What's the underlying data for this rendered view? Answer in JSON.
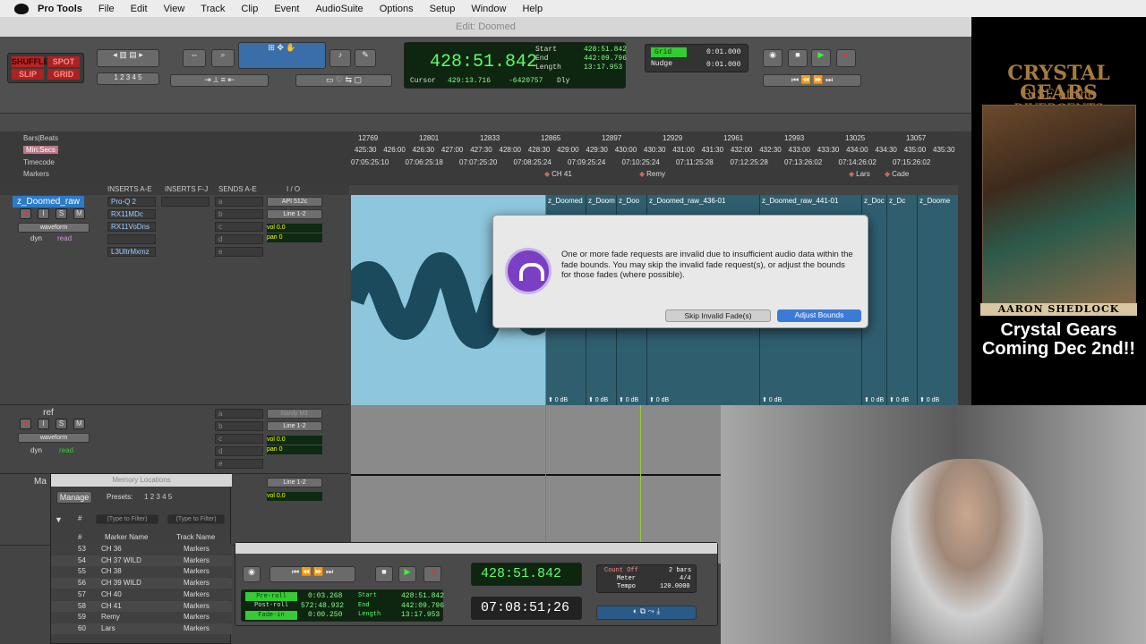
{
  "menubar": {
    "app": "Pro Tools",
    "items": [
      "File",
      "Edit",
      "View",
      "Track",
      "Clip",
      "Event",
      "AudioSuite",
      "Options",
      "Setup",
      "Window",
      "Help"
    ]
  },
  "window": {
    "title": "Edit: Doomed"
  },
  "toolbar": {
    "modes": [
      "SHUFFLE",
      "SPOT",
      "SLIP",
      "GRID"
    ],
    "nums": [
      "1",
      "2",
      "3",
      "4",
      "5"
    ],
    "main_counter": "428:51.842",
    "start_label": "Start",
    "end_label": "End",
    "length_label": "Length",
    "start": "428:51.842",
    "end": "442:09.796",
    "length": "13:17.953",
    "cursor_label": "Cursor",
    "cursor": "429:13.716",
    "sample": "-6420757",
    "dly": "Dly",
    "grid_label": "Grid",
    "grid_value": "0:01.000",
    "nudge_label": "Nudge",
    "nudge_value": "0:01.000"
  },
  "rulers": {
    "labels": [
      "Bars|Beats",
      "Min:Secs",
      "Timecode",
      "Markers"
    ],
    "bars": [
      "12769",
      "12801",
      "12833",
      "12865",
      "12897",
      "12929",
      "12961",
      "12993",
      "13025",
      "13057"
    ],
    "minsecs": [
      "425:30",
      "426:00",
      "426:30",
      "427:00",
      "427:30",
      "428:00",
      "428:30",
      "429:00",
      "429:30",
      "430:00",
      "430:30",
      "431:00",
      "431:30",
      "432:00",
      "432:30",
      "433:00",
      "433:30",
      "434:00",
      "434:30",
      "435:00",
      "435:30"
    ],
    "timecode": [
      "07:05:25:10",
      "07:06:25:18",
      "07:07:25:20",
      "07:08:25:24",
      "07:09:25:24",
      "07:10:25:24",
      "07:11:25:28",
      "07:12:25:28",
      "07:13:26:02",
      "07:14:26:02",
      "07:15:26:02"
    ],
    "markers": [
      "CH 41",
      "Remy",
      "Lars",
      "Cade"
    ]
  },
  "mix_header": {
    "inserts_ae": "INSERTS A-E",
    "inserts_fj": "INSERTS F-J",
    "sends_ae": "SENDS A-E",
    "io": "I / O"
  },
  "tracks": [
    {
      "name": "z_Doomed_raw",
      "view": "waveform",
      "dyn": "dyn",
      "mode": "read",
      "inserts": [
        "Pro-Q 2",
        "RX11MDc",
        "RX11VoDns",
        "",
        "L3UltrMxmz"
      ],
      "sends": [
        "a",
        "b",
        "c",
        "d",
        "e"
      ],
      "input": "API 512c",
      "output": "Line 1-2",
      "vol": "0.0",
      "pan": "0"
    },
    {
      "name": "ref",
      "view": "waveform",
      "dyn": "dyn",
      "mode": "read",
      "inserts": [
        "",
        "",
        "",
        "",
        ""
      ],
      "sends": [
        "a",
        "b",
        "c",
        "d",
        "e"
      ],
      "input": "Nardy M1",
      "output": "Line 1-2",
      "vol": "0.0",
      "pan": "0"
    },
    {
      "name": "Ma",
      "output": "Line 1-2",
      "vol": "0.0"
    }
  ],
  "smb": {
    "rec": "●",
    "i": "I",
    "s": "S",
    "m": "M"
  },
  "clips": [
    {
      "name": "z_Doomed"
    },
    {
      "name": "z_Doom"
    },
    {
      "name": "z_Doo"
    },
    {
      "name": "z_Doomed_raw_436-01"
    },
    {
      "name": "z_Doomed_raw_441-01"
    },
    {
      "name": "z_Doc"
    },
    {
      "name": "z_Dc"
    },
    {
      "name": "z_Doome"
    }
  ],
  "fade": "0 dB",
  "dialog": {
    "message": "One or more fade requests are invalid due to insufficient audio data within the fade bounds.  You may skip the invalid fade request(s), or adjust the bounds for those fades (where possible).",
    "skip": "Skip Invalid Fade(s)",
    "adjust": "Adjust Bounds"
  },
  "memory": {
    "title": "Memory Locations",
    "manage": "Manage",
    "presets": "Presets:",
    "preset_nums": [
      "1",
      "2",
      "3",
      "4",
      "5"
    ],
    "hash": "#",
    "filter1": "(Type to Filter)",
    "filter2": "(Type to Filter)",
    "col_marker": "Marker Name",
    "col_track": "Track Name",
    "rows": [
      {
        "n": "53",
        "name": "CH 36",
        "track": "Markers"
      },
      {
        "n": "54",
        "name": "CH 37 WILD",
        "track": "Markers"
      },
      {
        "n": "55",
        "name": "CH 38",
        "track": "Markers"
      },
      {
        "n": "56",
        "name": "CH 39 WILD",
        "track": "Markers"
      },
      {
        "n": "57",
        "name": "CH 40",
        "track": "Markers"
      },
      {
        "n": "58",
        "name": "CH 41",
        "track": "Markers"
      },
      {
        "n": "59",
        "name": "Remy",
        "track": "Markers"
      },
      {
        "n": "60",
        "name": "Lars",
        "track": "Markers"
      }
    ]
  },
  "transport": {
    "counter1": "428:51.842",
    "counter2": "07:08:51;26",
    "preroll": "Pre-roll",
    "postroll": "Post-roll",
    "fadein": "Fade-in",
    "preroll_v": "0:03.268",
    "postroll_v": "572:48.932",
    "fadein_v": "0:00.250",
    "start": "428:51.842",
    "end": "442:09.796",
    "length": "13:17.953",
    "countoff": "Count Off",
    "countoff_v": "2 bars",
    "meter": "Meter",
    "meter_v": "4/4",
    "tempo": "Tempo",
    "tempo_v": "120.0000"
  },
  "poster": {
    "title": "CRYSTAL GEARS",
    "subtitle": "RISE of the DIVERGENTS",
    "author": "AARON SHEDLOCK",
    "coming": "Crystal Gears Coming Dec 2nd!!"
  }
}
